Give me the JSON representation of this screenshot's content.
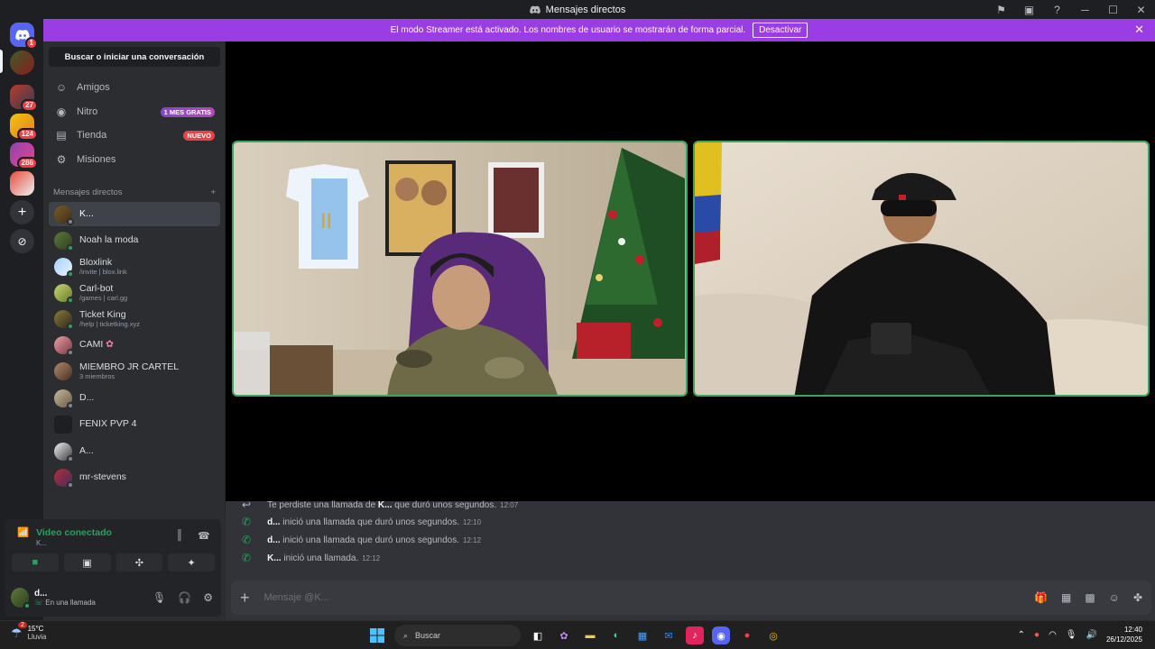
{
  "window": {
    "title": "Mensajes directos"
  },
  "banner": {
    "text": "El modo Streamer está activado. Los nombres de usuario se mostrarán de forma parcial.",
    "button": "Desactivar"
  },
  "servers": [
    {
      "badge": "1"
    },
    {
      "badge": ""
    },
    {
      "badge": "27"
    },
    {
      "badge": "124"
    },
    {
      "badge": "286"
    },
    {
      "badge": ""
    }
  ],
  "sidebar": {
    "search": "Buscar o iniciar una conversación",
    "nav": [
      {
        "label": "Amigos",
        "tag": ""
      },
      {
        "label": "Nitro",
        "tag": "1 MES GRATIS"
      },
      {
        "label": "Tienda",
        "tag": "NUEVO"
      },
      {
        "label": "Misiones",
        "tag": ""
      }
    ],
    "dm_header": "Mensajes directos",
    "dms": [
      {
        "name": "K...",
        "sub": ""
      },
      {
        "name": "Noah la moda",
        "sub": ""
      },
      {
        "name": "Bloxlink",
        "sub": "/invite | blox.link"
      },
      {
        "name": "Carl-bot",
        "sub": "/games | carl.gg"
      },
      {
        "name": "Ticket King",
        "sub": "/help | ticketking.xyz"
      },
      {
        "name": "CAMI",
        "sub": ""
      },
      {
        "name": "MIEMBRO JR CARTEL",
        "sub": "3 miembros"
      },
      {
        "name": "D...",
        "sub": ""
      },
      {
        "name": "FENIX PVP 4",
        "sub": ""
      },
      {
        "name": "A...",
        "sub": ""
      },
      {
        "name": "mr-stevens",
        "sub": ""
      }
    ]
  },
  "voice": {
    "status": "Video conectado",
    "channel": "K...",
    "user": "d...",
    "user_status": "En una llamada"
  },
  "chat": {
    "messages": [
      {
        "pre": "Te perdiste una llamada de ",
        "bold": "K...",
        "post": " que duró unos segundos.",
        "time": "12:07"
      },
      {
        "pre": "",
        "bold": "d...",
        "post": " inició una llamada que duró unos segundos.",
        "time": "12:10"
      },
      {
        "pre": "",
        "bold": "d...",
        "post": " inició una llamada que duró unos segundos.",
        "time": "12:12"
      },
      {
        "pre": "",
        "bold": "K...",
        "post": " inició una llamada.",
        "time": "12:12"
      }
    ],
    "placeholder": "Mensaje @K..."
  },
  "taskbar": {
    "badge": "2",
    "temp": "15°C",
    "weather": "Lluvia",
    "search": "Buscar",
    "time": "12:40",
    "date": "26/12/2025"
  },
  "colors": {
    "accent": "#5865f2",
    "banner": "#9b3de5",
    "online": "#23a55a",
    "speaking": "#3ba55c"
  }
}
